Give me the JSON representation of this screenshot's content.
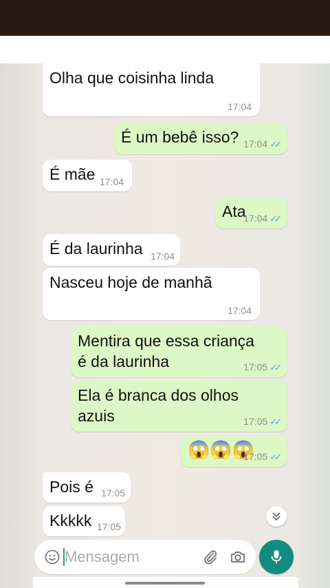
{
  "colors": {
    "incoming_bubble": "#ffffff",
    "outgoing_bubble": "#dcf8c6",
    "read_ticks": "#4fa3e0",
    "mic_button": "#128c7e",
    "top_bar": "#2a1812"
  },
  "messages": [
    {
      "direction": "incoming",
      "text": "Olha que coisinha linda",
      "time": "17:04"
    },
    {
      "direction": "outgoing",
      "text": "É um bebê isso?",
      "time": "17:04",
      "status": "read"
    },
    {
      "direction": "incoming",
      "text": "É mãe",
      "time": "17:04"
    },
    {
      "direction": "outgoing",
      "text": "Ata",
      "time": "17:04",
      "status": "read"
    },
    {
      "direction": "incoming",
      "text": "É da laurinha",
      "time": "17:04"
    },
    {
      "direction": "incoming",
      "text": "Nasceu hoje de manhã",
      "time": "17:04"
    },
    {
      "direction": "outgoing",
      "text": "Mentira que essa criança\né da laurinha",
      "time": "17:05",
      "status": "read"
    },
    {
      "direction": "outgoing",
      "text": "Ela é branca dos olhos\nazuis",
      "time": "17:05",
      "status": "read"
    },
    {
      "direction": "outgoing",
      "text": "😱😱😱",
      "time": "17:05",
      "status": "read"
    },
    {
      "direction": "incoming",
      "text": "Pois é",
      "time": "17:05"
    },
    {
      "direction": "incoming",
      "text": "Kkkkk",
      "time": "17:05"
    }
  ],
  "read_ticks_glyph": "✓✓",
  "scroll_down_icon": "double-chevron-down-icon",
  "composer": {
    "placeholder": "Mensagem",
    "emoji_icon": "emoji-icon",
    "attach_icon": "paperclip-icon",
    "camera_icon": "camera-icon"
  },
  "mic_icon": "microphone-icon"
}
